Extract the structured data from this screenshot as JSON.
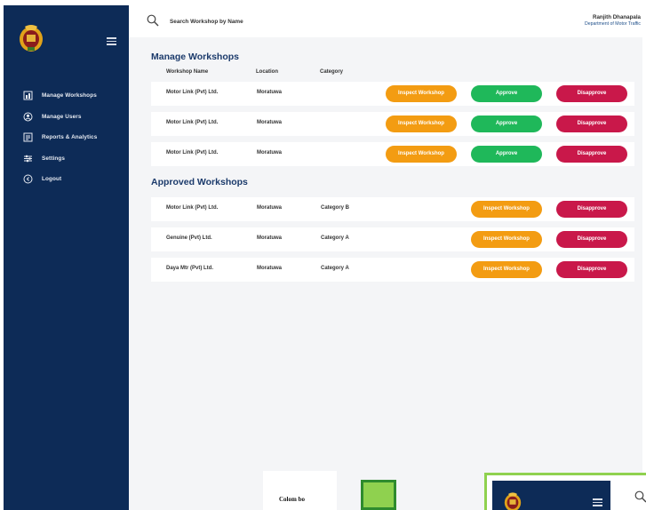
{
  "topbar": {
    "search_placeholder": "Search Workshop by Name",
    "user_name": "Ranjith Dhanapala",
    "user_department": "Department of Motor Traffic"
  },
  "sidebar": {
    "items": [
      {
        "label": "Manage Workshops",
        "icon": "workshop-icon"
      },
      {
        "label": "Manage Users",
        "icon": "users-icon"
      },
      {
        "label": "Reports & Analytics",
        "icon": "reports-icon"
      },
      {
        "label": "Settings",
        "icon": "settings-icon"
      },
      {
        "label": "Logout",
        "icon": "logout-icon"
      }
    ]
  },
  "manage_section": {
    "title": "Manage Workshops",
    "columns": {
      "name": "Workshop Name",
      "location": "Location",
      "category": "Category"
    },
    "rows": [
      {
        "name": "Motor Link (Pvt) Ltd.",
        "location": "Moratuwa",
        "category": ""
      },
      {
        "name": "Motor Link (Pvt) Ltd.",
        "location": "Moratuwa",
        "category": ""
      },
      {
        "name": "Motor Link (Pvt) Ltd.",
        "location": "Moratuwa",
        "category": ""
      }
    ]
  },
  "approved_section": {
    "title": "Approved Workshops",
    "rows": [
      {
        "name": "Motor Link (Pvt) Ltd.",
        "location": "Moratuwa",
        "category": "Category B"
      },
      {
        "name": "Genuine (Pvt) Ltd.",
        "location": "Moratuwa",
        "category": "Category A"
      },
      {
        "name": "Daya Mtr (Pvt) Ltd.",
        "location": "Moratuwa",
        "category": "Category A"
      }
    ]
  },
  "buttons": {
    "inspect": "Inspect Workshop",
    "approve": "Approve",
    "disapprove": "Disapprove"
  },
  "fragment": {
    "text": "Colom bo"
  },
  "colors": {
    "sidebar_bg": "#0d2b57",
    "heading": "#1b3a6b",
    "inspect": "#f39c12",
    "approve": "#1fb85a",
    "disapprove": "#c9184a"
  }
}
